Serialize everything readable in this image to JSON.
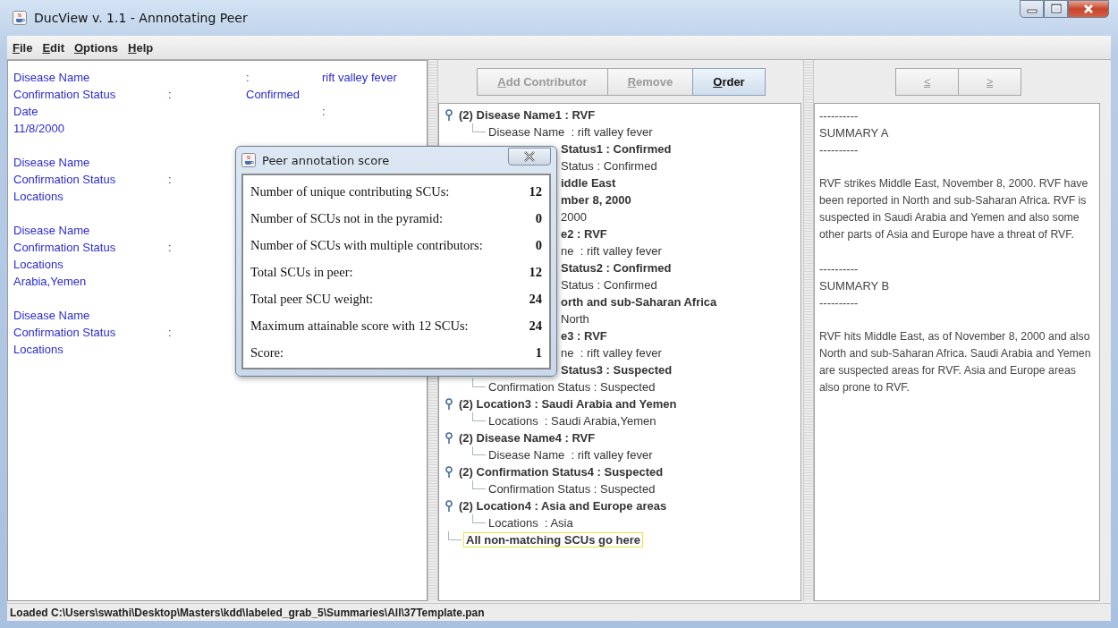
{
  "window": {
    "title": "DucView v. 1.1 - Annnotating Peer"
  },
  "menu": [
    "File",
    "Edit",
    "Options",
    "Help"
  ],
  "left_panel": {
    "groups": [
      [
        {
          "col_1": "Disease Name",
          "col_3": ":",
          "col_4": "rift valley fever"
        },
        {
          "col_1": "Confirmation Status",
          "col_2": ":",
          "col_3": "Confirmed"
        },
        {
          "col_1": "Date",
          "col_4": ":"
        },
        {
          "col_1": "11/8/2000"
        }
      ],
      [
        {
          "col_1": "Disease Name"
        },
        {
          "col_1": "Confirmation Status",
          "col_2": ":"
        },
        {
          "col_1": "Locations"
        }
      ],
      [
        {
          "col_1": "Disease Name"
        },
        {
          "col_1": "Confirmation Status",
          "col_2": ":"
        },
        {
          "col_1": "Locations"
        },
        {
          "col_1": "Arabia,Yemen"
        }
      ],
      [
        {
          "col_1": "Disease Name"
        },
        {
          "col_1": "Confirmation Status",
          "col_2": ":"
        },
        {
          "col_1": "Locations"
        }
      ]
    ]
  },
  "toolbar": [
    {
      "label": "Add Contributor",
      "disabled": true
    },
    {
      "label": "Remove",
      "disabled": true
    },
    {
      "label": "Order",
      "disabled": false
    }
  ],
  "tree": {
    "items": [
      {
        "text": "(2) Disease Name1 : RVF",
        "kind": "node",
        "covered": false,
        "selected": false,
        "children": [
          {
            "text": "Disease Name  : rift valley fever",
            "kind": "leaf",
            "covered": false,
            "selected": false
          }
        ]
      },
      {
        "text": "Status1 : Confirmed",
        "kind": "node",
        "covered": true,
        "selected": false,
        "children": [
          {
            "text": "Status : Confirmed",
            "kind": "leaf",
            "covered": true,
            "selected": false
          }
        ]
      },
      {
        "text": "iddle East",
        "kind": "node",
        "covered": true,
        "selected": false
      },
      {
        "text": "mber 8, 2000",
        "kind": "node",
        "covered": true,
        "selected": false,
        "children": [
          {
            "text": "2000",
            "kind": "leaf",
            "covered": true,
            "selected": false
          }
        ]
      },
      {
        "text": "e2 : RVF",
        "kind": "node",
        "covered": true,
        "selected": false,
        "children": [
          {
            "text": "ne  : rift valley fever",
            "kind": "leaf",
            "covered": true,
            "selected": false
          }
        ]
      },
      {
        "text": "Status2 : Confirmed",
        "kind": "node",
        "covered": true,
        "selected": false,
        "children": [
          {
            "text": "Status : Confirmed",
            "kind": "leaf",
            "covered": true,
            "selected": false
          }
        ]
      },
      {
        "text": "orth and sub-Saharan Africa",
        "kind": "node",
        "covered": true,
        "selected": false,
        "children": [
          {
            "text": "North",
            "kind": "leaf",
            "covered": true,
            "selected": false
          }
        ]
      },
      {
        "text": "e3 : RVF",
        "kind": "node",
        "covered": true,
        "selected": false,
        "children": [
          {
            "text": "ne  : rift valley fever",
            "kind": "leaf",
            "covered": true,
            "selected": false
          }
        ]
      },
      {
        "text": "Status3 : Suspected",
        "kind": "node",
        "covered": true,
        "selected": false,
        "children": [
          {
            "text": "Confirmation Status : Suspected",
            "kind": "leaf",
            "covered": false,
            "selected": false
          }
        ]
      },
      {
        "text": "(2) Location3 : Saudi Arabia and Yemen",
        "kind": "node",
        "covered": false,
        "selected": false,
        "children": [
          {
            "text": "Locations  : Saudi Arabia,Yemen",
            "kind": "leaf",
            "covered": false,
            "selected": false
          }
        ]
      },
      {
        "text": "(2) Disease Name4 : RVF",
        "kind": "node",
        "covered": false,
        "selected": false,
        "children": [
          {
            "text": "Disease Name  : rift valley fever",
            "kind": "leaf",
            "covered": false,
            "selected": false
          }
        ]
      },
      {
        "text": "(2) Confirmation Status4 : Suspected",
        "kind": "node",
        "covered": false,
        "selected": false,
        "children": [
          {
            "text": "Confirmation Status : Suspected",
            "kind": "leaf",
            "covered": false,
            "selected": false
          }
        ]
      },
      {
        "text": "(2) Location4 : Asia and Europe areas",
        "kind": "node",
        "covered": false,
        "selected": false,
        "children": [
          {
            "text": "Locations  : Asia",
            "kind": "leaf",
            "covered": false,
            "selected": false
          }
        ]
      },
      {
        "text": "All non-matching SCUs go here",
        "kind": "catch_all",
        "covered": false,
        "selected": true
      }
    ]
  },
  "nav_buttons": [
    {
      "label": "≤",
      "disabled": true
    },
    {
      "label": "≥",
      "disabled": true
    }
  ],
  "summary_text": [
    {
      "kind": "rule",
      "text": "----------"
    },
    {
      "kind": "heading",
      "text": "SUMMARY A"
    },
    {
      "kind": "rule",
      "text": "----------"
    },
    {
      "kind": "paragraph",
      "text": "RVF strikes Middle East, November 8, 2000. RVF have been reported in North and sub-Saharan Africa. RVF is suspected in Saudi Arabia and Yemen and also some other parts of Asia and Europe have a threat of RVF."
    },
    {
      "kind": "rule",
      "text": "----------"
    },
    {
      "kind": "heading",
      "text": "SUMMARY B"
    },
    {
      "kind": "rule",
      "text": "----------"
    },
    {
      "kind": "paragraph",
      "text": "RVF hits Middle East, as of November 8, 2000 and also North and sub-Saharan Africa. Saudi Arabia and Yemen are suspected areas for RVF. Asia and Europe areas also prone to RVF."
    }
  ],
  "dialog": {
    "title": "Peer annotation score",
    "rows": [
      {
        "label": "Number of unique contributing SCUs:",
        "value": "12"
      },
      {
        "label": "Number of SCUs not in the pyramid:",
        "value": "0"
      },
      {
        "label": "Number of SCUs with multiple contributors:",
        "value": "0"
      },
      {
        "label": "Total SCUs in peer:",
        "value": "12"
      },
      {
        "label": "Total peer SCU weight:",
        "value": "24"
      },
      {
        "label": "Maximum attainable score with 12 SCUs:",
        "value": "24"
      },
      {
        "label": "Score:",
        "value": "1"
      }
    ]
  },
  "status_bar": {
    "text": "Loaded C:\\Users\\swathi\\Desktop\\Masters\\kdd\\labeled_grab_5\\Summaries\\All\\37Template.pan"
  }
}
